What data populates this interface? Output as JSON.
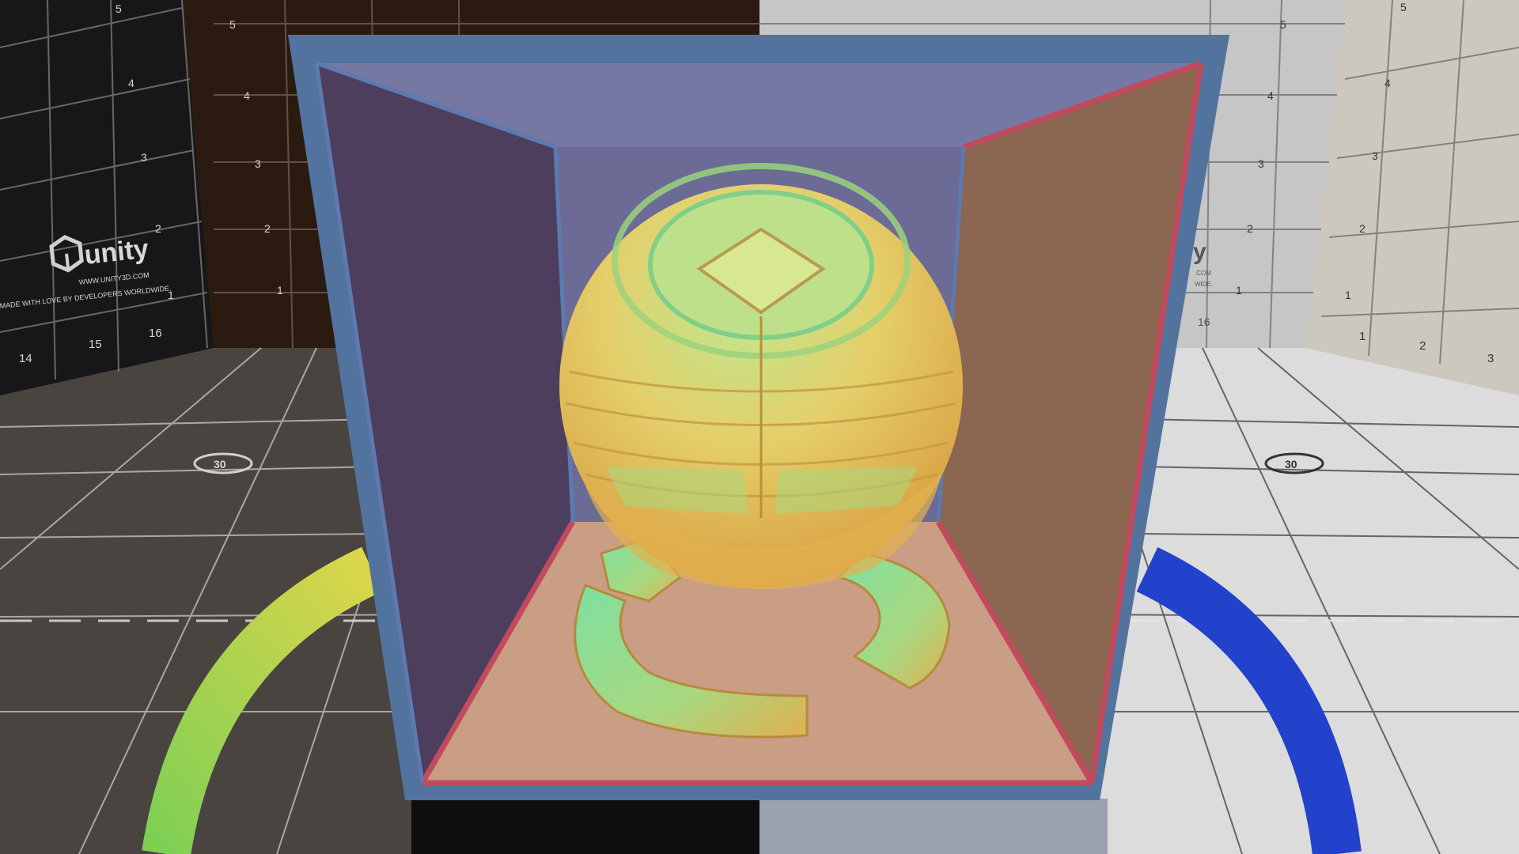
{
  "scene": {
    "type": "unity-material-preview",
    "left_backdrop": {
      "brand_name": "unity",
      "url": "WWW.UNITY3D.COM",
      "tagline": "MADE WITH LOVE BY DEVELOPERS WORLDWIDE.",
      "vertical_ticks": [
        "5",
        "4",
        "3",
        "2",
        "1"
      ],
      "ruler_numbers": [
        "14",
        "15",
        "16"
      ],
      "floor_badge": "30"
    },
    "center_backdrop": {
      "vertical_ticks": [
        "5",
        "4",
        "3",
        "2",
        "1"
      ]
    },
    "right_backdrop": {
      "brand_fragment": "y",
      "url_fragment": ".COM",
      "tagline_fragment": "WIDE.",
      "ruler_number": "16",
      "vertical_ticks": [
        "5",
        "4",
        "3",
        "2",
        "1"
      ],
      "floor_badge": "30"
    },
    "far_right_backdrop": {
      "vertical_ticks": [
        "5",
        "4",
        "3",
        "2",
        "1"
      ],
      "ruler_numbers": [
        "1",
        "2",
        "3"
      ]
    },
    "colors": {
      "box_frame": "#52739e",
      "box_edge_red": "#c24a5e",
      "box_ceiling": "#7578a2",
      "box_back": "#6b6b96",
      "box_left": "#4e3e5d",
      "box_right": "#8b6650",
      "box_floor": "#c99e85",
      "sphere_yellow": "#e8c25e",
      "sphere_green": "#8fe08c",
      "arc_left_start": "#8bd45a",
      "arc_left_end": "#d8d44a",
      "arc_right": "#1f3cc8"
    }
  }
}
